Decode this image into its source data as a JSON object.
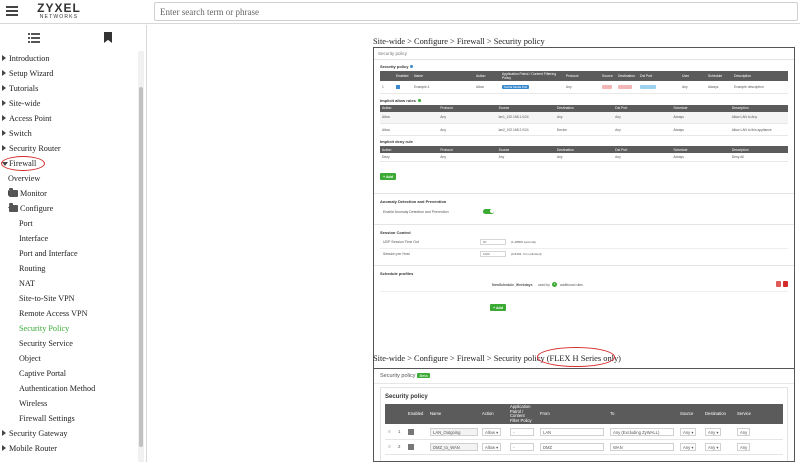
{
  "logo": {
    "brand": "ZYXEL",
    "sub": "NETWORKS"
  },
  "search": {
    "placeholder": "Enter search term or phrase"
  },
  "sidebar": {
    "items": [
      {
        "label": "Introduction",
        "level": 0,
        "caret": "right"
      },
      {
        "label": "Setup Wizard",
        "level": 0,
        "caret": "right"
      },
      {
        "label": "Tutorials",
        "level": 0,
        "caret": "right"
      },
      {
        "label": "Site-wide",
        "level": 0,
        "caret": "right"
      },
      {
        "label": "Access Point",
        "level": 0,
        "caret": "right"
      },
      {
        "label": "Switch",
        "level": 0,
        "caret": "right"
      },
      {
        "label": "Security Router",
        "level": 0,
        "caret": "right"
      },
      {
        "label": "Firewall",
        "level": 0,
        "caret": "down",
        "highlight": true
      },
      {
        "label": "Overview",
        "level": 1
      },
      {
        "label": "Monitor",
        "level": 1,
        "folder": true,
        "caret": "right"
      },
      {
        "label": "Configure",
        "level": 1,
        "folder": true,
        "caret": "down"
      },
      {
        "label": "Port",
        "level": 2
      },
      {
        "label": "Interface",
        "level": 2
      },
      {
        "label": "Port and Interface",
        "level": 2
      },
      {
        "label": "Routing",
        "level": 2
      },
      {
        "label": "NAT",
        "level": 2
      },
      {
        "label": "Site-to-Site VPN",
        "level": 2
      },
      {
        "label": "Remote Access VPN",
        "level": 2
      },
      {
        "label": "Security Policy",
        "level": 2,
        "active": true
      },
      {
        "label": "Security Service",
        "level": 2
      },
      {
        "label": "Object",
        "level": 2
      },
      {
        "label": "Captive Portal",
        "level": 2
      },
      {
        "label": "Authentication Method",
        "level": 2
      },
      {
        "label": "Wireless",
        "level": 2
      },
      {
        "label": "Firewall Settings",
        "level": 2
      },
      {
        "label": "Security Gateway",
        "level": 0,
        "caret": "right"
      },
      {
        "label": "Mobile Router",
        "level": 0,
        "caret": "right"
      }
    ]
  },
  "content": {
    "breadcrumb1": "Site-wide > Configure > Firewall > Security policy",
    "breadcrumb2": "Site-wide > Configure > Firewall > Security policy (FLEX H Series only)",
    "shot1": {
      "header": "Security policy",
      "policy_title": "Security policy",
      "policy_columns": [
        "",
        "Enabled",
        "Name",
        "Action",
        "Application Patrol / Content Filtering Policy",
        "Protocol",
        "Source",
        "Destination",
        "Dst Port",
        "User",
        "Schedule",
        "Description"
      ],
      "policy_row": [
        "1",
        "",
        "Example-1",
        "Allow",
        "Social Media Poli",
        "Any",
        "",
        "",
        "",
        "Any",
        "Always",
        "Example description"
      ],
      "allow_title": "Implicit allow rules",
      "allow_columns": [
        "Action",
        "Protocol",
        "Source",
        "Destination",
        "Dst Port",
        "Schedule",
        "Description"
      ],
      "allow_rows": [
        [
          "Allow",
          "Any",
          "lan1_192.168.1.0/24",
          "Any",
          "Any",
          "Always",
          "Allow LAN to Any"
        ],
        [
          "Allow",
          "Any",
          "lan2_192.168.2.0/24",
          "Device",
          "Any",
          "Always",
          "Allow LAN to this appliance"
        ]
      ],
      "deny_title": "Implicit deny rule",
      "deny_columns": [
        "Action",
        "Protocol",
        "Source",
        "Destination",
        "Dst Port",
        "Schedule",
        "Description"
      ],
      "deny_row": [
        "Deny",
        "Any",
        "Any",
        "Any",
        "Any",
        "Always",
        "Deny All"
      ],
      "add_label": "+ Add",
      "anomaly_title": "Anomaly Detection and Prevention",
      "anomaly_label": "Enable Anomaly Detection and Prevention",
      "session_title": "Session Control",
      "udp_label": "UDP Session Time Out",
      "udp_value": "60",
      "udp_hint": "(1-28800 seconds)",
      "session_label": "Session per Host",
      "session_value": "1000",
      "session_hint": "(0-8192, 0 is unlimited)",
      "schedule_title": "Schedule profiles",
      "schedule_name": "NewSchedule_Weekdays",
      "schedule_used": "used by",
      "schedule_count": "1",
      "schedule_rules": "additional rules",
      "add2_label": "+ Add"
    },
    "shot2": {
      "header": "Security policy",
      "beta": "Beta",
      "title": "Security policy",
      "columns": [
        "",
        "",
        "Enabled",
        "Name",
        "Action",
        "Application Patrol / Content Filter Policy",
        "From",
        "To",
        "Source",
        "Destination",
        "Service"
      ],
      "rows": [
        {
          "num": "1",
          "name": "LAN_Outgoing",
          "action": "Allow",
          "app": "-",
          "from": "LAN",
          "to": "Any (Excluding ZyWALL)",
          "source": "Any",
          "destination": "Any",
          "service": "Any"
        },
        {
          "num": "2",
          "name": "DMZ_to_WAN",
          "action": "Allow",
          "app": "-",
          "from": "DMZ",
          "to": "WAN",
          "source": "Any",
          "destination": "Any",
          "service": "Any"
        }
      ]
    }
  }
}
